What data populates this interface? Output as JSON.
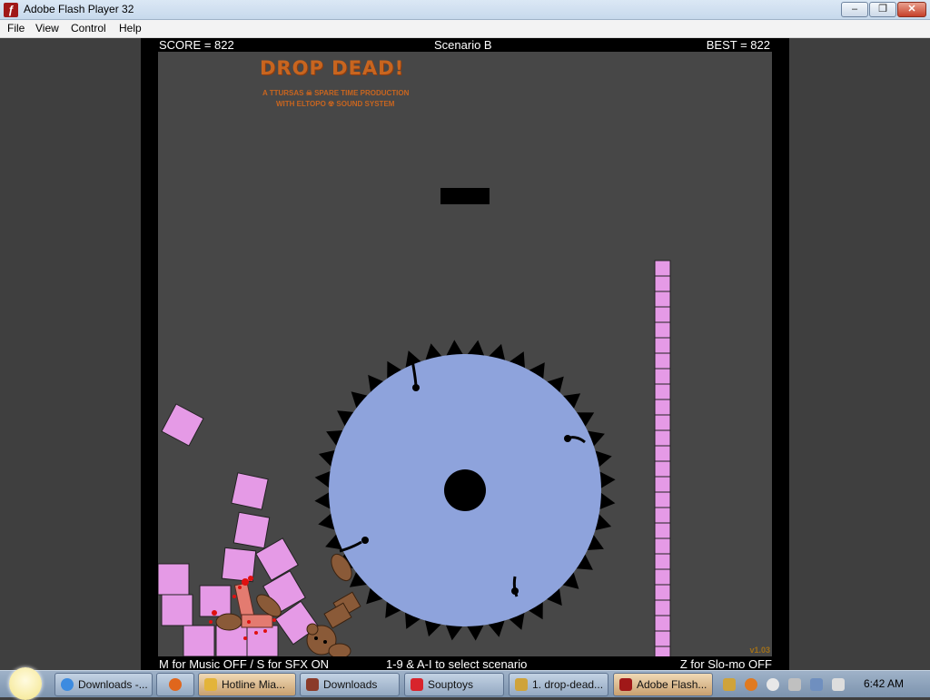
{
  "window": {
    "title": "Adobe Flash Player 32",
    "min_label": "–",
    "max_label": "❐",
    "close_label": "✕"
  },
  "menu": {
    "items": [
      "File",
      "View",
      "Control",
      "Help"
    ]
  },
  "hud": {
    "score": "SCORE = 822",
    "scenario": "Scenario B",
    "best": "BEST = 822"
  },
  "footer": {
    "music": "M for Music OFF / S for SFX ON",
    "select": "1-9 & A-I to select scenario",
    "slomo": "Z for Slo-mo OFF"
  },
  "logo": {
    "title": "DROP DEAD!",
    "line1": "A TTURSAS ☠ SPARE TIME PRODUCTION",
    "line2": "WITH ELTOPO ☢ SOUND SYSTEM"
  },
  "version": "v1.03",
  "taskbar": {
    "items": [
      {
        "label": "Downloads -...",
        "icon": "chrome-icon",
        "color": "#3c8be0"
      },
      {
        "label": "",
        "icon": "firefox-icon",
        "color": "#e0661c"
      },
      {
        "label": "Hotline Mia...",
        "icon": "folder-icon",
        "color": "#e3b43a"
      },
      {
        "label": "Downloads",
        "icon": "game-icon",
        "color": "#8b3b2a"
      },
      {
        "label": "Souptoys",
        "icon": "souptoys-icon",
        "color": "#d8242c"
      },
      {
        "label": "1. drop-dead...",
        "icon": "link-icon",
        "color": "#cfa33a"
      },
      {
        "label": "Adobe Flash...",
        "icon": "flash-icon",
        "color": "#a01818"
      }
    ],
    "clock": "6:42 AM"
  },
  "colors": {
    "saw": "#8ea3dc",
    "block": "#e59ae6",
    "bear": "#8a5a38",
    "background": "#474747"
  }
}
